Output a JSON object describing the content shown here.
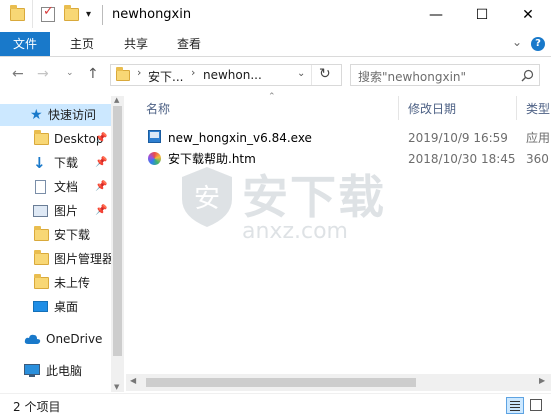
{
  "window": {
    "title": "newhongxin",
    "minimize": "—",
    "maximize": "☐",
    "close": "✕"
  },
  "ribbon": {
    "tabs": [
      "文件",
      "主页",
      "共享",
      "查看"
    ],
    "expand": "⌄",
    "help": "?"
  },
  "address": {
    "crumbs": [
      "安下...",
      "newhon..."
    ],
    "refresh": "↻"
  },
  "search": {
    "placeholder": "搜索\"newhongxin\""
  },
  "nav": {
    "items": [
      {
        "label": "快速访问",
        "icon": "star-icon"
      },
      {
        "label": "Desktop",
        "icon": "folder-icon",
        "pinned": true
      },
      {
        "label": "下载",
        "icon": "download-arrow-icon",
        "pinned": true
      },
      {
        "label": "文档",
        "icon": "document-icon",
        "pinned": true
      },
      {
        "label": "图片",
        "icon": "picture-icon",
        "pinned": true
      },
      {
        "label": "安下载",
        "icon": "folder-icon"
      },
      {
        "label": "图片管理器",
        "icon": "folder-icon"
      },
      {
        "label": "未上传",
        "icon": "folder-icon"
      },
      {
        "label": "桌面",
        "icon": "desktop-icon"
      },
      {
        "label": "OneDrive",
        "icon": "cloud-icon"
      },
      {
        "label": "此电脑",
        "icon": "computer-icon"
      }
    ]
  },
  "columns": {
    "name": "名称",
    "modified": "修改日期",
    "type": "类型"
  },
  "files": [
    {
      "name": "new_hongxin_v6.84.exe",
      "modified": "2019/10/9 16:59",
      "type": "应用",
      "icon": "exe-icon"
    },
    {
      "name": "安下载帮助.htm",
      "modified": "2018/10/30 18:45",
      "type": "360",
      "icon": "htm-icon"
    }
  ],
  "watermark": {
    "cn": "安下载",
    "en": "anxz.com"
  },
  "status": {
    "count": "2 个项目"
  },
  "colors": {
    "accent": "#1979ca",
    "folder": "#f8d775",
    "selected": "#cce8ff"
  }
}
